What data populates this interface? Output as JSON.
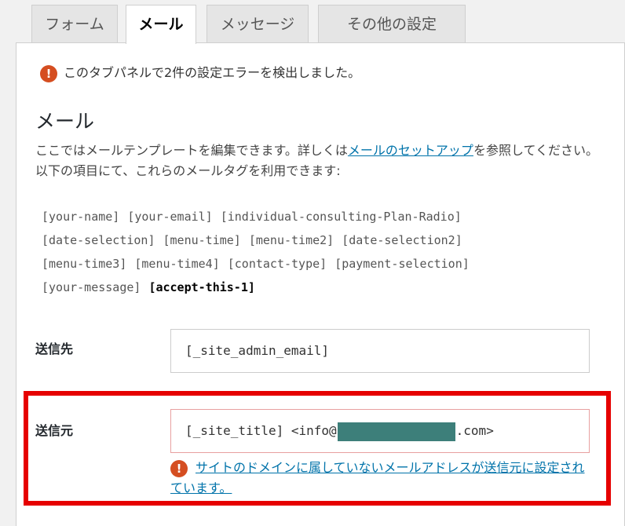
{
  "tabs": [
    {
      "label": "フォーム"
    },
    {
      "label": "メール"
    },
    {
      "label": "メッセージ"
    },
    {
      "label": "その他の設定"
    }
  ],
  "panel": {
    "tab_error": "このタブパネルで2件の設定エラーを検出しました。",
    "title": "メール",
    "description_before": "ここではメールテンプレートを編集できます。詳しくは",
    "description_link": "メールのセットアップ",
    "description_after": "を参照してください。",
    "tags_intro": "以下の項目にて、これらのメールタグを利用できます:",
    "tags": [
      "[your-name]",
      "[your-email]",
      "[individual-consulting-Plan-Radio]",
      "[date-selection]",
      "[menu-time]",
      "[menu-time2]",
      "[date-selection2]",
      "[menu-time3]",
      "[menu-time4]",
      "[contact-type]",
      "[payment-selection]",
      "[your-message]"
    ],
    "tag_strong": "[accept-this-1]"
  },
  "fields": {
    "to_label": "送信先",
    "to_value": "[_site_admin_email]",
    "from_label": "送信元",
    "from_value_prefix": "[_site_title] <info@",
    "from_value_suffix": ".com>",
    "from_error": "サイトのドメインに属していないメールアドレスが送信元に設定されています。"
  },
  "icons": {
    "error": "error-icon"
  },
  "colors": {
    "error": "#d54e21",
    "link": "#0073aa",
    "highlight": "#e60000",
    "redaction": "#3d7f7a"
  }
}
